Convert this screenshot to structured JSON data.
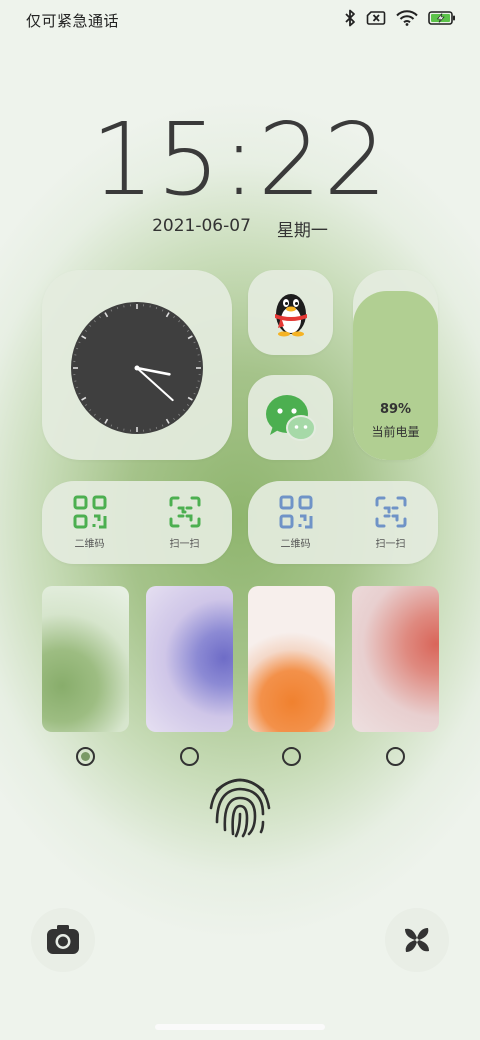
{
  "status_bar": {
    "carrier_text": "仅可紧急通话",
    "icons": [
      "bluetooth-icon",
      "no-sim-icon",
      "wifi-icon",
      "battery-charging-icon"
    ]
  },
  "lockscreen": {
    "time": "15:22",
    "date": "2021-06-07",
    "weekday": "星期一"
  },
  "clock_widget": {
    "hour": 15,
    "minute": 22
  },
  "apps": [
    {
      "name": "qq-app-icon"
    },
    {
      "name": "wechat-app-icon"
    }
  ],
  "battery_widget": {
    "percent_text": "89%",
    "label": "当前电量",
    "level": 0.89,
    "fill_color": "#b1cf92"
  },
  "shortcut_cards": [
    {
      "items": [
        {
          "icon": "qr-code-icon",
          "label": "二维码"
        },
        {
          "icon": "scan-icon",
          "label": "扫一扫"
        }
      ],
      "accent": "#4caf50"
    },
    {
      "items": [
        {
          "icon": "qr-code-icon",
          "label": "二维码"
        },
        {
          "icon": "scan-icon",
          "label": "扫一扫"
        }
      ],
      "accent": "#6f93c7"
    }
  ],
  "themes": [
    {
      "name": "green",
      "color": "#88ad6b",
      "selected": true
    },
    {
      "name": "purple",
      "color": "#6e6cc7",
      "selected": false
    },
    {
      "name": "orange",
      "color": "#f0812f",
      "selected": false
    },
    {
      "name": "red",
      "color": "#d9665a",
      "selected": false
    }
  ],
  "bottom_actions": {
    "left": "camera-icon",
    "right": "pinwheel-icon"
  }
}
